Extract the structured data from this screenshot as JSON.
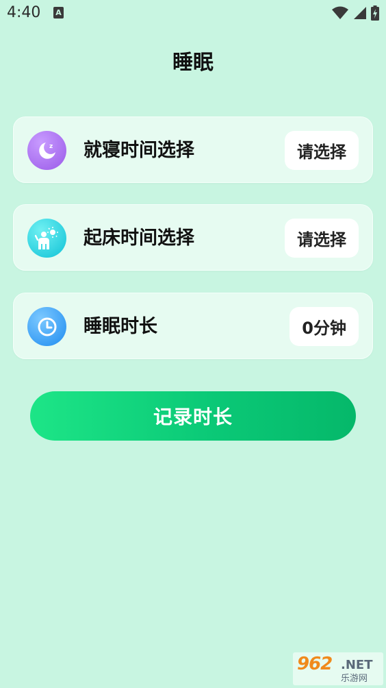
{
  "status_bar": {
    "time": "4:40",
    "notification_letter": "A",
    "icons": [
      "wifi-icon",
      "signal-icon",
      "battery-icon"
    ]
  },
  "header": {
    "title": "睡眠"
  },
  "cards": [
    {
      "label": "就寝时间选择",
      "value": "请选择",
      "icon": "moon-icon",
      "icon_color": "#a86ef0"
    },
    {
      "label": "起床时间选择",
      "value": "请选择",
      "icon": "wake-up-icon",
      "icon_color": "#19cfdc"
    },
    {
      "label": "睡眠时长",
      "value": "0分钟",
      "icon": "clock-icon",
      "icon_color": "#2f9bf5"
    }
  ],
  "actions": {
    "record_label": "记录时长"
  },
  "watermark": {
    "logo": "962",
    "suffix": ".NET",
    "sub": "乐游网"
  },
  "colors": {
    "background": "#c8f5e1",
    "card": "#e6fbf1",
    "button_start": "#1de587",
    "button_end": "#05b86a"
  }
}
